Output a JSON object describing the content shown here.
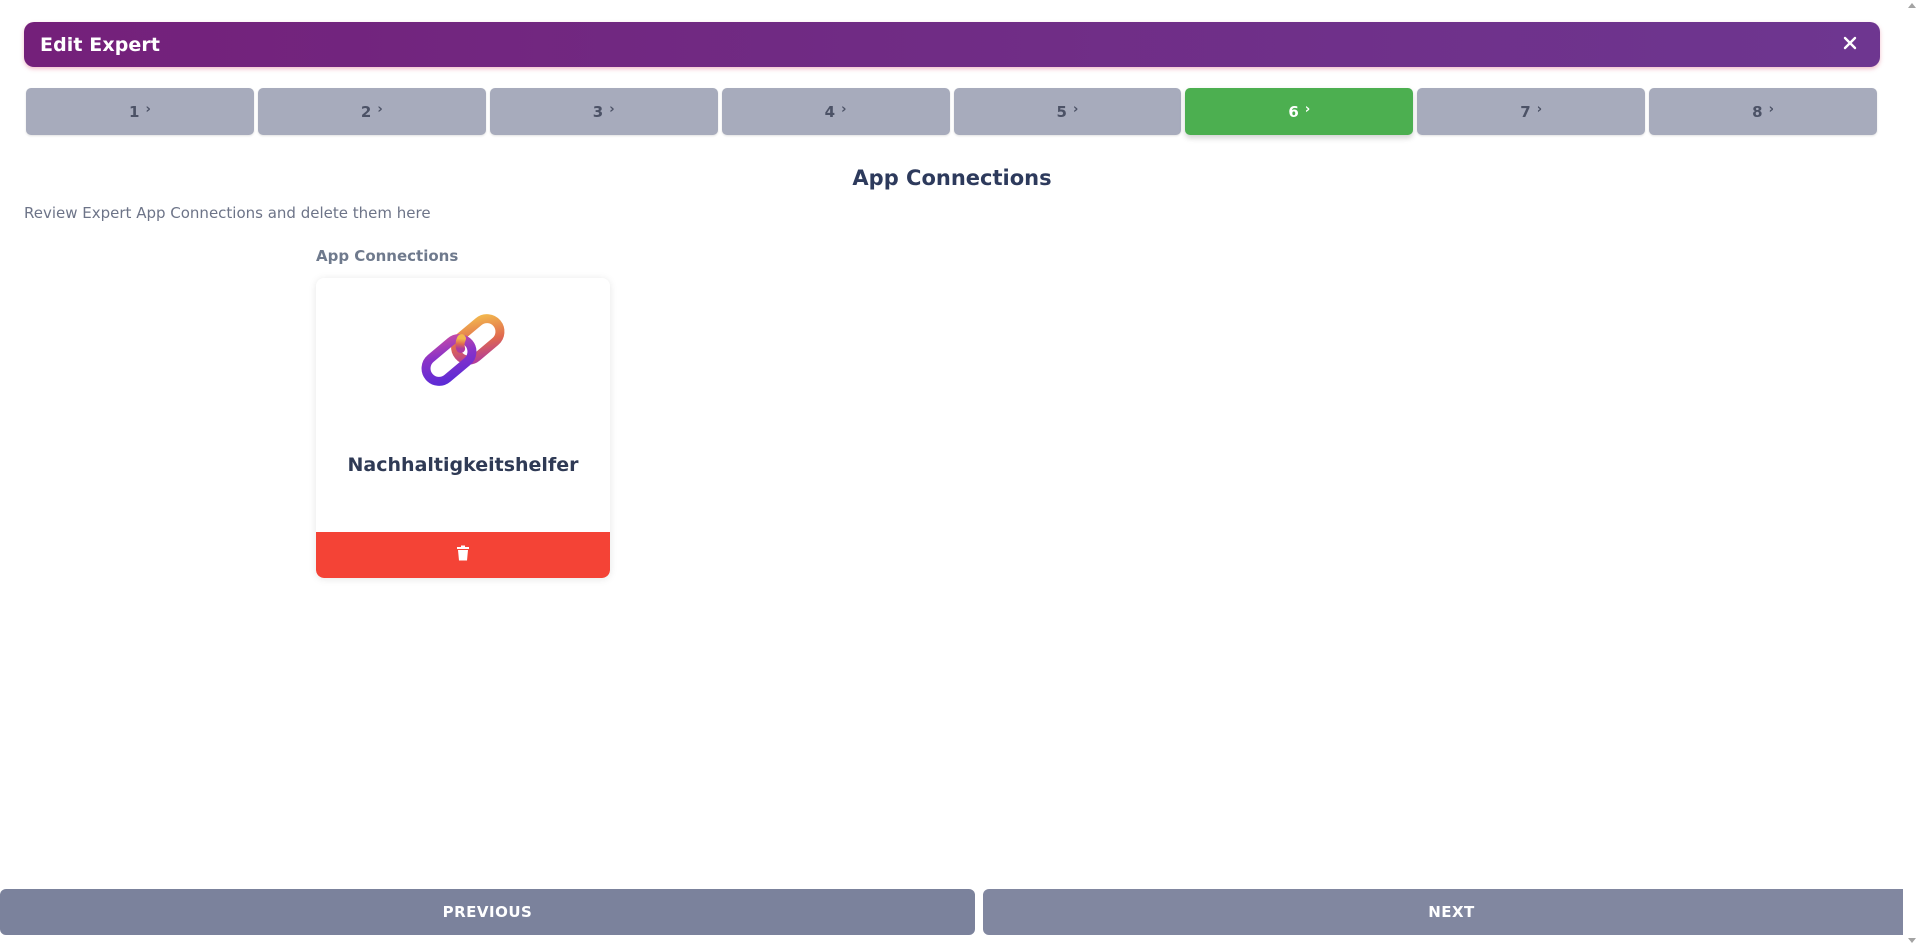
{
  "dialog": {
    "title": "Edit Expert",
    "close_icon": "close-icon",
    "header_gradient": [
      "#74207a",
      "#6e3690"
    ]
  },
  "stepper": {
    "active_step": 6,
    "active_color": "#4caf50",
    "inactive_color": "#a7abbc",
    "chevron": "›",
    "steps": [
      {
        "label": "1"
      },
      {
        "label": "2"
      },
      {
        "label": "3"
      },
      {
        "label": "4"
      },
      {
        "label": "5"
      },
      {
        "label": "6"
      },
      {
        "label": "7"
      },
      {
        "label": "8"
      }
    ]
  },
  "section": {
    "title": "App Connections",
    "subtitle": "Review Expert App Connections and delete them here",
    "list_label": "App Connections"
  },
  "connections": [
    {
      "name": "Nachhaltigkeitshelfer",
      "icon": "chain-link-icon",
      "delete_icon": "trash-icon",
      "delete_color": "#f44336"
    }
  ],
  "navigation": {
    "previous_label": "PREVIOUS",
    "next_label": "NEXT"
  }
}
